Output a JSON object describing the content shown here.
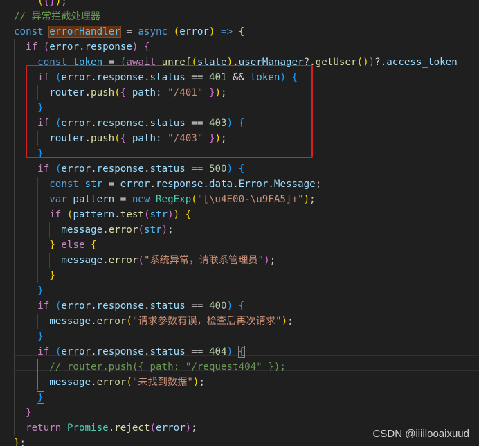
{
  "editor": {
    "lines": [
      [
        {
          "t": "    ",
          "c": "txt"
        },
        {
          "t": "(",
          "c": "p1"
        },
        {
          "t": "",
          "c": "txt"
        },
        {
          "t": "{",
          "c": "p2"
        },
        {
          "t": "}",
          "c": "p2"
        },
        {
          "t": ")",
          "c": "p1"
        },
        {
          "t": ";",
          "c": "txt"
        }
      ],
      [
        {
          "t": "// 异常拦截处理器",
          "c": "comment"
        }
      ],
      [
        {
          "t": "const",
          "c": "kw"
        },
        {
          "t": " ",
          "c": "txt"
        },
        {
          "t": "errorHandler",
          "c": "const",
          "hl": true
        },
        {
          "t": " = ",
          "c": "op"
        },
        {
          "t": "async",
          "c": "kw"
        },
        {
          "t": " ",
          "c": "txt"
        },
        {
          "t": "(",
          "c": "p1"
        },
        {
          "t": "error",
          "c": "var"
        },
        {
          "t": ")",
          "c": "p1"
        },
        {
          "t": " => ",
          "c": "kw"
        },
        {
          "t": "{",
          "c": "p1"
        }
      ],
      [
        {
          "t": "  ",
          "c": "txt"
        },
        {
          "t": "if",
          "c": "ctrl"
        },
        {
          "t": " ",
          "c": "txt"
        },
        {
          "t": "(",
          "c": "p2"
        },
        {
          "t": "error",
          "c": "var"
        },
        {
          "t": ".",
          "c": "op"
        },
        {
          "t": "response",
          "c": "var"
        },
        {
          "t": ")",
          "c": "p2"
        },
        {
          "t": " ",
          "c": "txt"
        },
        {
          "t": "{",
          "c": "p2"
        }
      ],
      [
        {
          "t": "    ",
          "c": "txt"
        },
        {
          "t": "const",
          "c": "kw"
        },
        {
          "t": " ",
          "c": "txt"
        },
        {
          "t": "token",
          "c": "const"
        },
        {
          "t": " = ",
          "c": "op"
        },
        {
          "t": "(",
          "c": "p3"
        },
        {
          "t": "await",
          "c": "ctrl"
        },
        {
          "t": " ",
          "c": "txt"
        },
        {
          "t": "unref",
          "c": "fn"
        },
        {
          "t": "(",
          "c": "p1"
        },
        {
          "t": "state",
          "c": "var"
        },
        {
          "t": ")",
          "c": "p1"
        },
        {
          "t": ".",
          "c": "op"
        },
        {
          "t": "userManager",
          "c": "var"
        },
        {
          "t": "?.",
          "c": "op"
        },
        {
          "t": "getUser",
          "c": "fn"
        },
        {
          "t": "(",
          "c": "p1"
        },
        {
          "t": ")",
          "c": "p1"
        },
        {
          "t": ")",
          "c": "p3"
        },
        {
          "t": "?.",
          "c": "op"
        },
        {
          "t": "access_token",
          "c": "var"
        }
      ],
      [
        {
          "t": "    ",
          "c": "txt"
        },
        {
          "t": "if",
          "c": "ctrl"
        },
        {
          "t": " ",
          "c": "txt"
        },
        {
          "t": "(",
          "c": "p3"
        },
        {
          "t": "error",
          "c": "var"
        },
        {
          "t": ".",
          "c": "op"
        },
        {
          "t": "response",
          "c": "var"
        },
        {
          "t": ".",
          "c": "op"
        },
        {
          "t": "status",
          "c": "var"
        },
        {
          "t": " == ",
          "c": "op"
        },
        {
          "t": "401",
          "c": "num"
        },
        {
          "t": " && ",
          "c": "op"
        },
        {
          "t": "token",
          "c": "const"
        },
        {
          "t": ")",
          "c": "p3"
        },
        {
          "t": " ",
          "c": "txt"
        },
        {
          "t": "{",
          "c": "p3"
        }
      ],
      [
        {
          "t": "      ",
          "c": "txt"
        },
        {
          "t": "router",
          "c": "var"
        },
        {
          "t": ".",
          "c": "op"
        },
        {
          "t": "push",
          "c": "fn"
        },
        {
          "t": "(",
          "c": "p1"
        },
        {
          "t": "{",
          "c": "p2"
        },
        {
          "t": " ",
          "c": "txt"
        },
        {
          "t": "path",
          "c": "var"
        },
        {
          "t": ": ",
          "c": "op"
        },
        {
          "t": "\"/401\"",
          "c": "str"
        },
        {
          "t": " ",
          "c": "txt"
        },
        {
          "t": "}",
          "c": "p2"
        },
        {
          "t": ")",
          "c": "p1"
        },
        {
          "t": ";",
          "c": "op"
        }
      ],
      [
        {
          "t": "    ",
          "c": "txt"
        },
        {
          "t": "}",
          "c": "p3"
        }
      ],
      [
        {
          "t": "    ",
          "c": "txt"
        },
        {
          "t": "if",
          "c": "ctrl"
        },
        {
          "t": " ",
          "c": "txt"
        },
        {
          "t": "(",
          "c": "p3"
        },
        {
          "t": "error",
          "c": "var"
        },
        {
          "t": ".",
          "c": "op"
        },
        {
          "t": "response",
          "c": "var"
        },
        {
          "t": ".",
          "c": "op"
        },
        {
          "t": "status",
          "c": "var"
        },
        {
          "t": " == ",
          "c": "op"
        },
        {
          "t": "403",
          "c": "num"
        },
        {
          "t": ")",
          "c": "p3"
        },
        {
          "t": " ",
          "c": "txt"
        },
        {
          "t": "{",
          "c": "p3"
        }
      ],
      [
        {
          "t": "      ",
          "c": "txt"
        },
        {
          "t": "router",
          "c": "var"
        },
        {
          "t": ".",
          "c": "op"
        },
        {
          "t": "push",
          "c": "fn"
        },
        {
          "t": "(",
          "c": "p1"
        },
        {
          "t": "{",
          "c": "p2"
        },
        {
          "t": " ",
          "c": "txt"
        },
        {
          "t": "path",
          "c": "var"
        },
        {
          "t": ": ",
          "c": "op"
        },
        {
          "t": "\"/403\"",
          "c": "str"
        },
        {
          "t": " ",
          "c": "txt"
        },
        {
          "t": "}",
          "c": "p2"
        },
        {
          "t": ")",
          "c": "p1"
        },
        {
          "t": ";",
          "c": "op"
        }
      ],
      [
        {
          "t": "    ",
          "c": "txt"
        },
        {
          "t": "}",
          "c": "p3"
        }
      ],
      [
        {
          "t": "    ",
          "c": "txt"
        },
        {
          "t": "if",
          "c": "ctrl"
        },
        {
          "t": " ",
          "c": "txt"
        },
        {
          "t": "(",
          "c": "p3"
        },
        {
          "t": "error",
          "c": "var"
        },
        {
          "t": ".",
          "c": "op"
        },
        {
          "t": "response",
          "c": "var"
        },
        {
          "t": ".",
          "c": "op"
        },
        {
          "t": "status",
          "c": "var"
        },
        {
          "t": " == ",
          "c": "op"
        },
        {
          "t": "500",
          "c": "num"
        },
        {
          "t": ")",
          "c": "p3"
        },
        {
          "t": " ",
          "c": "txt"
        },
        {
          "t": "{",
          "c": "p3"
        }
      ],
      [
        {
          "t": "      ",
          "c": "txt"
        },
        {
          "t": "const",
          "c": "kw"
        },
        {
          "t": " ",
          "c": "txt"
        },
        {
          "t": "str",
          "c": "const"
        },
        {
          "t": " = ",
          "c": "op"
        },
        {
          "t": "error",
          "c": "var"
        },
        {
          "t": ".",
          "c": "op"
        },
        {
          "t": "response",
          "c": "var"
        },
        {
          "t": ".",
          "c": "op"
        },
        {
          "t": "data",
          "c": "var"
        },
        {
          "t": ".",
          "c": "op"
        },
        {
          "t": "Error",
          "c": "var"
        },
        {
          "t": ".",
          "c": "op"
        },
        {
          "t": "Message",
          "c": "var"
        },
        {
          "t": ";",
          "c": "op"
        }
      ],
      [
        {
          "t": "      ",
          "c": "txt"
        },
        {
          "t": "var",
          "c": "kw"
        },
        {
          "t": " ",
          "c": "txt"
        },
        {
          "t": "pattern",
          "c": "var"
        },
        {
          "t": " = ",
          "c": "op"
        },
        {
          "t": "new",
          "c": "kw"
        },
        {
          "t": " ",
          "c": "txt"
        },
        {
          "t": "RegExp",
          "c": "type"
        },
        {
          "t": "(",
          "c": "p1"
        },
        {
          "t": "\"[\\u4E00-\\u9FA5]+\"",
          "c": "str"
        },
        {
          "t": ")",
          "c": "p1"
        },
        {
          "t": ";",
          "c": "op"
        }
      ],
      [
        {
          "t": "      ",
          "c": "txt"
        },
        {
          "t": "if",
          "c": "ctrl"
        },
        {
          "t": " ",
          "c": "txt"
        },
        {
          "t": "(",
          "c": "p1"
        },
        {
          "t": "pattern",
          "c": "var"
        },
        {
          "t": ".",
          "c": "op"
        },
        {
          "t": "test",
          "c": "fn"
        },
        {
          "t": "(",
          "c": "p2"
        },
        {
          "t": "str",
          "c": "const"
        },
        {
          "t": ")",
          "c": "p2"
        },
        {
          "t": ")",
          "c": "p1"
        },
        {
          "t": " ",
          "c": "txt"
        },
        {
          "t": "{",
          "c": "p1"
        }
      ],
      [
        {
          "t": "        ",
          "c": "txt"
        },
        {
          "t": "message",
          "c": "var"
        },
        {
          "t": ".",
          "c": "op"
        },
        {
          "t": "error",
          "c": "fn"
        },
        {
          "t": "(",
          "c": "p2"
        },
        {
          "t": "str",
          "c": "const"
        },
        {
          "t": ")",
          "c": "p2"
        },
        {
          "t": ";",
          "c": "op"
        }
      ],
      [
        {
          "t": "      ",
          "c": "txt"
        },
        {
          "t": "}",
          "c": "p1"
        },
        {
          "t": " ",
          "c": "txt"
        },
        {
          "t": "else",
          "c": "ctrl"
        },
        {
          "t": " ",
          "c": "txt"
        },
        {
          "t": "{",
          "c": "p1"
        }
      ],
      [
        {
          "t": "        ",
          "c": "txt"
        },
        {
          "t": "message",
          "c": "var"
        },
        {
          "t": ".",
          "c": "op"
        },
        {
          "t": "error",
          "c": "fn"
        },
        {
          "t": "(",
          "c": "p2"
        },
        {
          "t": "\"系统异常，请联系管理员\"",
          "c": "str"
        },
        {
          "t": ")",
          "c": "p2"
        },
        {
          "t": ";",
          "c": "op"
        }
      ],
      [
        {
          "t": "      ",
          "c": "txt"
        },
        {
          "t": "}",
          "c": "p1"
        }
      ],
      [
        {
          "t": "    ",
          "c": "txt"
        },
        {
          "t": "}",
          "c": "p3"
        }
      ],
      [
        {
          "t": "    ",
          "c": "txt"
        },
        {
          "t": "if",
          "c": "ctrl"
        },
        {
          "t": " ",
          "c": "txt"
        },
        {
          "t": "(",
          "c": "p3"
        },
        {
          "t": "error",
          "c": "var"
        },
        {
          "t": ".",
          "c": "op"
        },
        {
          "t": "response",
          "c": "var"
        },
        {
          "t": ".",
          "c": "op"
        },
        {
          "t": "status",
          "c": "var"
        },
        {
          "t": " == ",
          "c": "op"
        },
        {
          "t": "400",
          "c": "num"
        },
        {
          "t": ")",
          "c": "p3"
        },
        {
          "t": " ",
          "c": "txt"
        },
        {
          "t": "{",
          "c": "p3"
        }
      ],
      [
        {
          "t": "      ",
          "c": "txt"
        },
        {
          "t": "message",
          "c": "var"
        },
        {
          "t": ".",
          "c": "op"
        },
        {
          "t": "error",
          "c": "fn"
        },
        {
          "t": "(",
          "c": "p1"
        },
        {
          "t": "\"请求参数有误，检查后再次请求\"",
          "c": "str"
        },
        {
          "t": ")",
          "c": "p1"
        },
        {
          "t": ";",
          "c": "op"
        }
      ],
      [
        {
          "t": "    ",
          "c": "txt"
        },
        {
          "t": "}",
          "c": "p3"
        }
      ],
      [
        {
          "t": "    ",
          "c": "txt"
        },
        {
          "t": "if",
          "c": "ctrl"
        },
        {
          "t": " ",
          "c": "txt"
        },
        {
          "t": "(",
          "c": "p3"
        },
        {
          "t": "error",
          "c": "var"
        },
        {
          "t": ".",
          "c": "op"
        },
        {
          "t": "response",
          "c": "var"
        },
        {
          "t": ".",
          "c": "op"
        },
        {
          "t": "status",
          "c": "var"
        },
        {
          "t": " == ",
          "c": "op"
        },
        {
          "t": "404",
          "c": "num"
        },
        {
          "t": ")",
          "c": "p3"
        },
        {
          "t": " ",
          "c": "txt"
        },
        {
          "t": "{",
          "c": "p3",
          "bm": true
        }
      ],
      [
        {
          "t": "      ",
          "c": "txt"
        },
        {
          "t": "// router.push({ path: \"/request404\" });",
          "c": "comment"
        }
      ],
      [
        {
          "t": "      ",
          "c": "txt"
        },
        {
          "t": "message",
          "c": "var"
        },
        {
          "t": ".",
          "c": "op"
        },
        {
          "t": "error",
          "c": "fn"
        },
        {
          "t": "(",
          "c": "p1"
        },
        {
          "t": "\"未找到数据\"",
          "c": "str"
        },
        {
          "t": ")",
          "c": "p1"
        },
        {
          "t": ";",
          "c": "op"
        }
      ],
      [
        {
          "t": "    ",
          "c": "txt"
        },
        {
          "t": "}",
          "c": "p3",
          "bm": true
        }
      ],
      [
        {
          "t": "  ",
          "c": "txt"
        },
        {
          "t": "}",
          "c": "p2"
        }
      ],
      [
        {
          "t": "  ",
          "c": "txt"
        },
        {
          "t": "return",
          "c": "ctrl"
        },
        {
          "t": " ",
          "c": "txt"
        },
        {
          "t": "Promise",
          "c": "type"
        },
        {
          "t": ".",
          "c": "op"
        },
        {
          "t": "reject",
          "c": "fn"
        },
        {
          "t": "(",
          "c": "p2"
        },
        {
          "t": "error",
          "c": "var"
        },
        {
          "t": ")",
          "c": "p2"
        },
        {
          "t": ";",
          "c": "op"
        }
      ],
      [
        {
          "t": "}",
          "c": "p1"
        },
        {
          "t": ";",
          "c": "op"
        }
      ]
    ]
  },
  "watermark": "CSDN @iiiilooaixuud",
  "annotation": {
    "color": "#d81e1e"
  }
}
